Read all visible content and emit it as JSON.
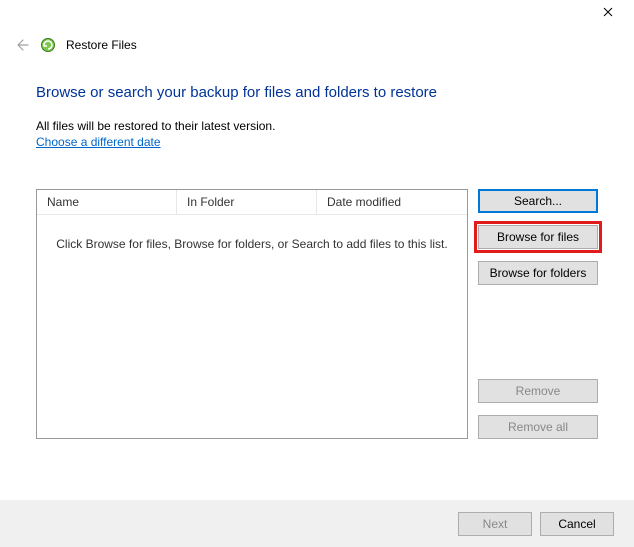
{
  "window": {
    "title": "Restore Files"
  },
  "heading": "Browse or search your backup for files and folders to restore",
  "subtext": "All files will be restored to their latest version.",
  "link_choose_date": "Choose a different date",
  "columns": {
    "name": "Name",
    "folder": "In Folder",
    "date": "Date modified"
  },
  "empty_message": "Click Browse for files, Browse for folders, or Search to add files to this list.",
  "buttons": {
    "search": "Search...",
    "browse_files": "Browse for files",
    "browse_folders": "Browse for folders",
    "remove": "Remove",
    "remove_all": "Remove all",
    "next": "Next",
    "cancel": "Cancel"
  }
}
